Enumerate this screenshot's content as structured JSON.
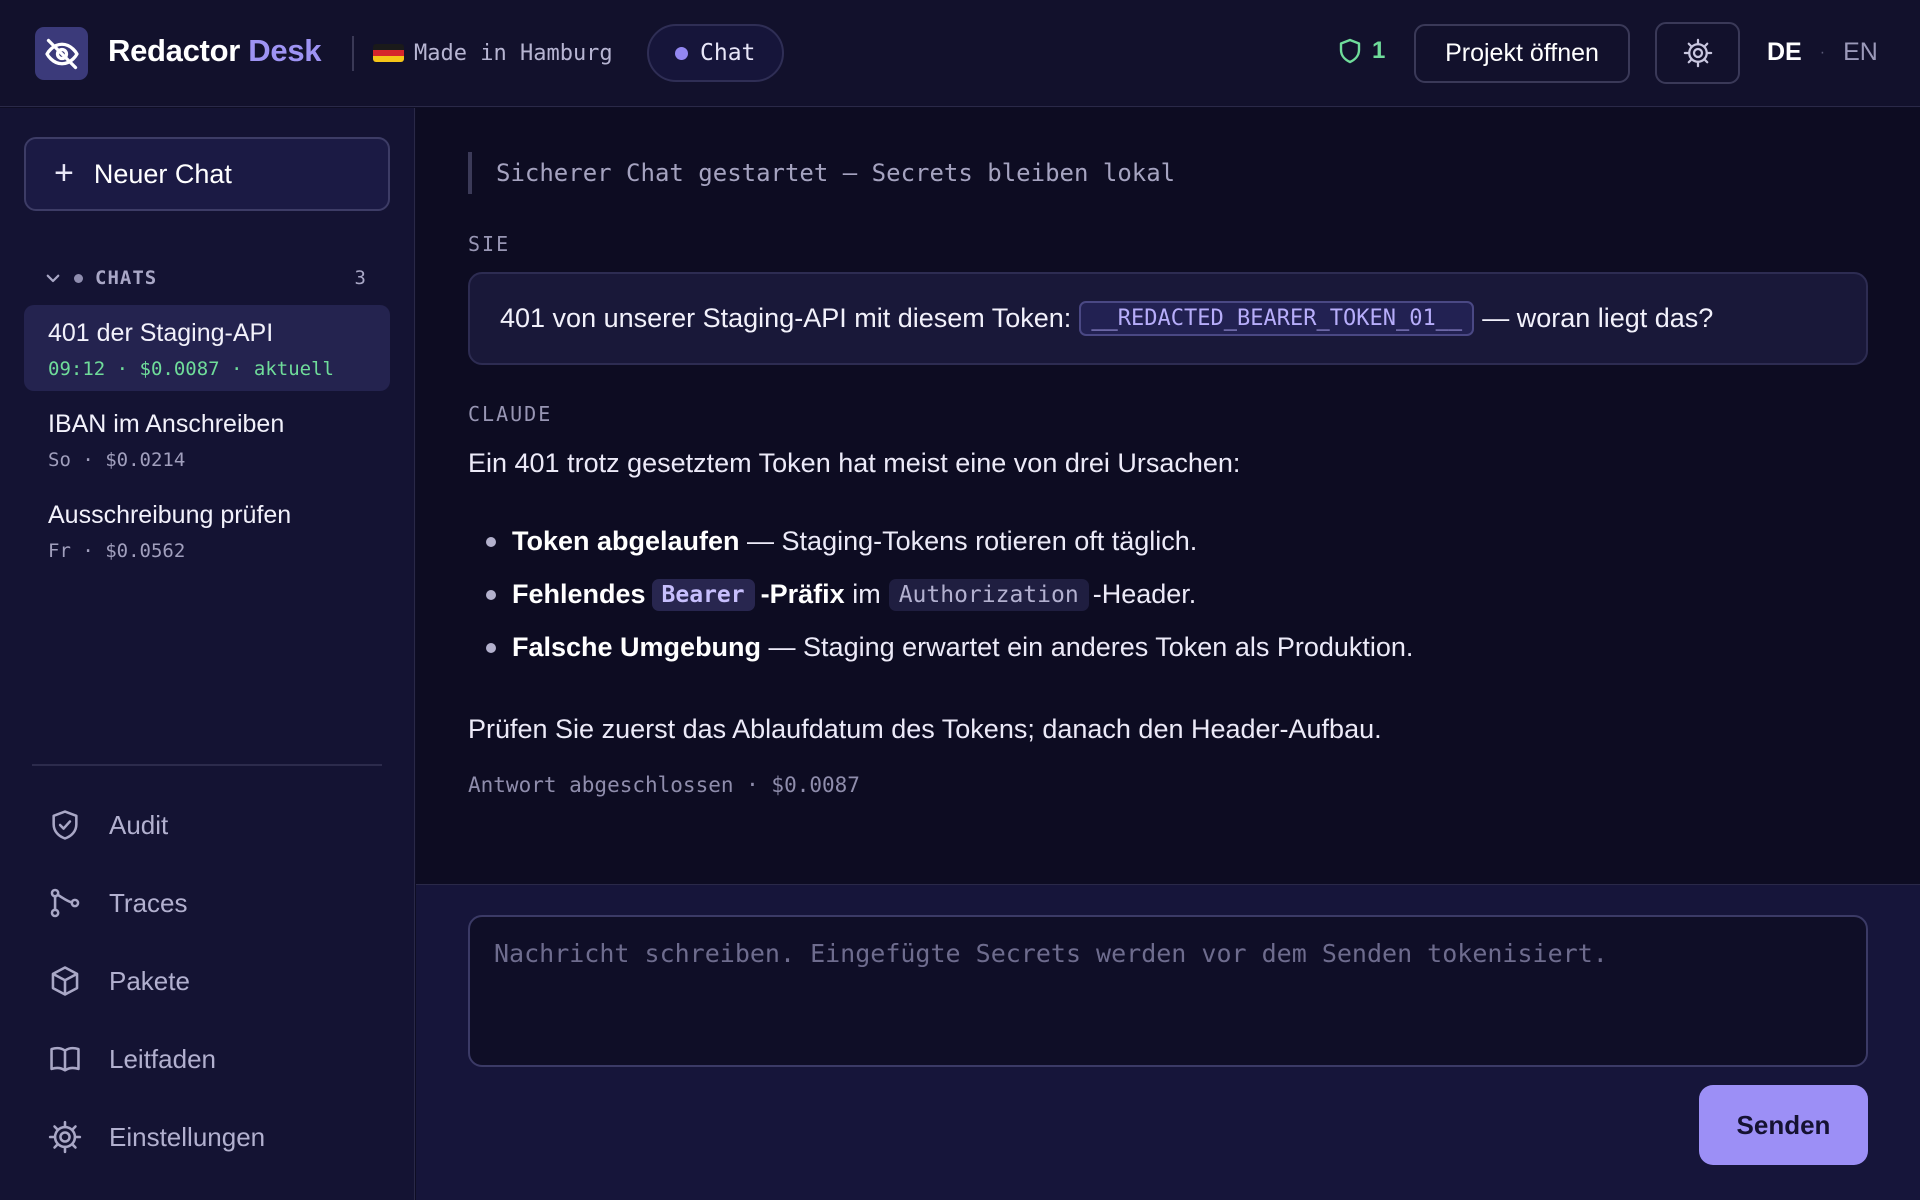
{
  "header": {
    "brand_main": "Redactor",
    "brand_accent": "Desk",
    "made_in": "Made in Hamburg",
    "chat_pill": "Chat",
    "shield_count": "1",
    "open_project": "Projekt öffnen",
    "lang_active": "DE",
    "lang_sep": "·",
    "lang_other": "EN"
  },
  "sidebar": {
    "new_chat": "Neuer Chat",
    "chats_title": "CHATS",
    "chats_count": "3",
    "chats": [
      {
        "title": "401 der Staging-API",
        "meta": "09:12 · $0.0087 · aktuell"
      },
      {
        "title": "IBAN im Anschreiben",
        "meta": "So · $0.0214"
      },
      {
        "title": "Ausschreibung prüfen",
        "meta": "Fr · $0.0562"
      }
    ],
    "nav": [
      {
        "label": "Audit",
        "icon": "shield-check-icon"
      },
      {
        "label": "Traces",
        "icon": "traces-icon"
      },
      {
        "label": "Pakete",
        "icon": "package-icon"
      },
      {
        "label": "Leitfaden",
        "icon": "book-icon"
      },
      {
        "label": "Einstellungen",
        "icon": "gear-icon"
      }
    ]
  },
  "conversation": {
    "system_line": "Sicherer Chat gestartet — Secrets bleiben lokal",
    "user_role": "SIE",
    "user_before": "401 von unserer Staging-API mit diesem Token:",
    "user_token": "__REDACTED_BEARER_TOKEN_01__",
    "user_after": "— woran liegt das?",
    "assistant_role": "CLAUDE",
    "intro": "Ein 401 trotz gesetztem Token hat meist eine von drei Ursachen:",
    "b1_bold": "Token abgelaufen",
    "b1_rest": " — Staging-Tokens rotieren oft täglich.",
    "b2_bold1": "Fehlendes",
    "b2_code1": "Bearer",
    "b2_bold2": "-Präfix",
    "b2_mid": " im",
    "b2_code2": "Authorization",
    "b2_rest": "-Header.",
    "b3_bold": "Falsche Umgebung",
    "b3_rest": " — Staging erwartet ein anderes Token als Produktion.",
    "closing": "Prüfen Sie zuerst das Ablaufdatum des Tokens; danach den Header-Aufbau.",
    "done": "Antwort abgeschlossen · $0.0087"
  },
  "composer": {
    "placeholder": "Nachricht schreiben. Eingefügte Secrets werden vor dem Senden tokenisiert.",
    "value": "",
    "send": "Senden"
  },
  "colors": {
    "accent": "#9e93f3",
    "success": "#6fdc9a",
    "background": "#0e0d24"
  }
}
